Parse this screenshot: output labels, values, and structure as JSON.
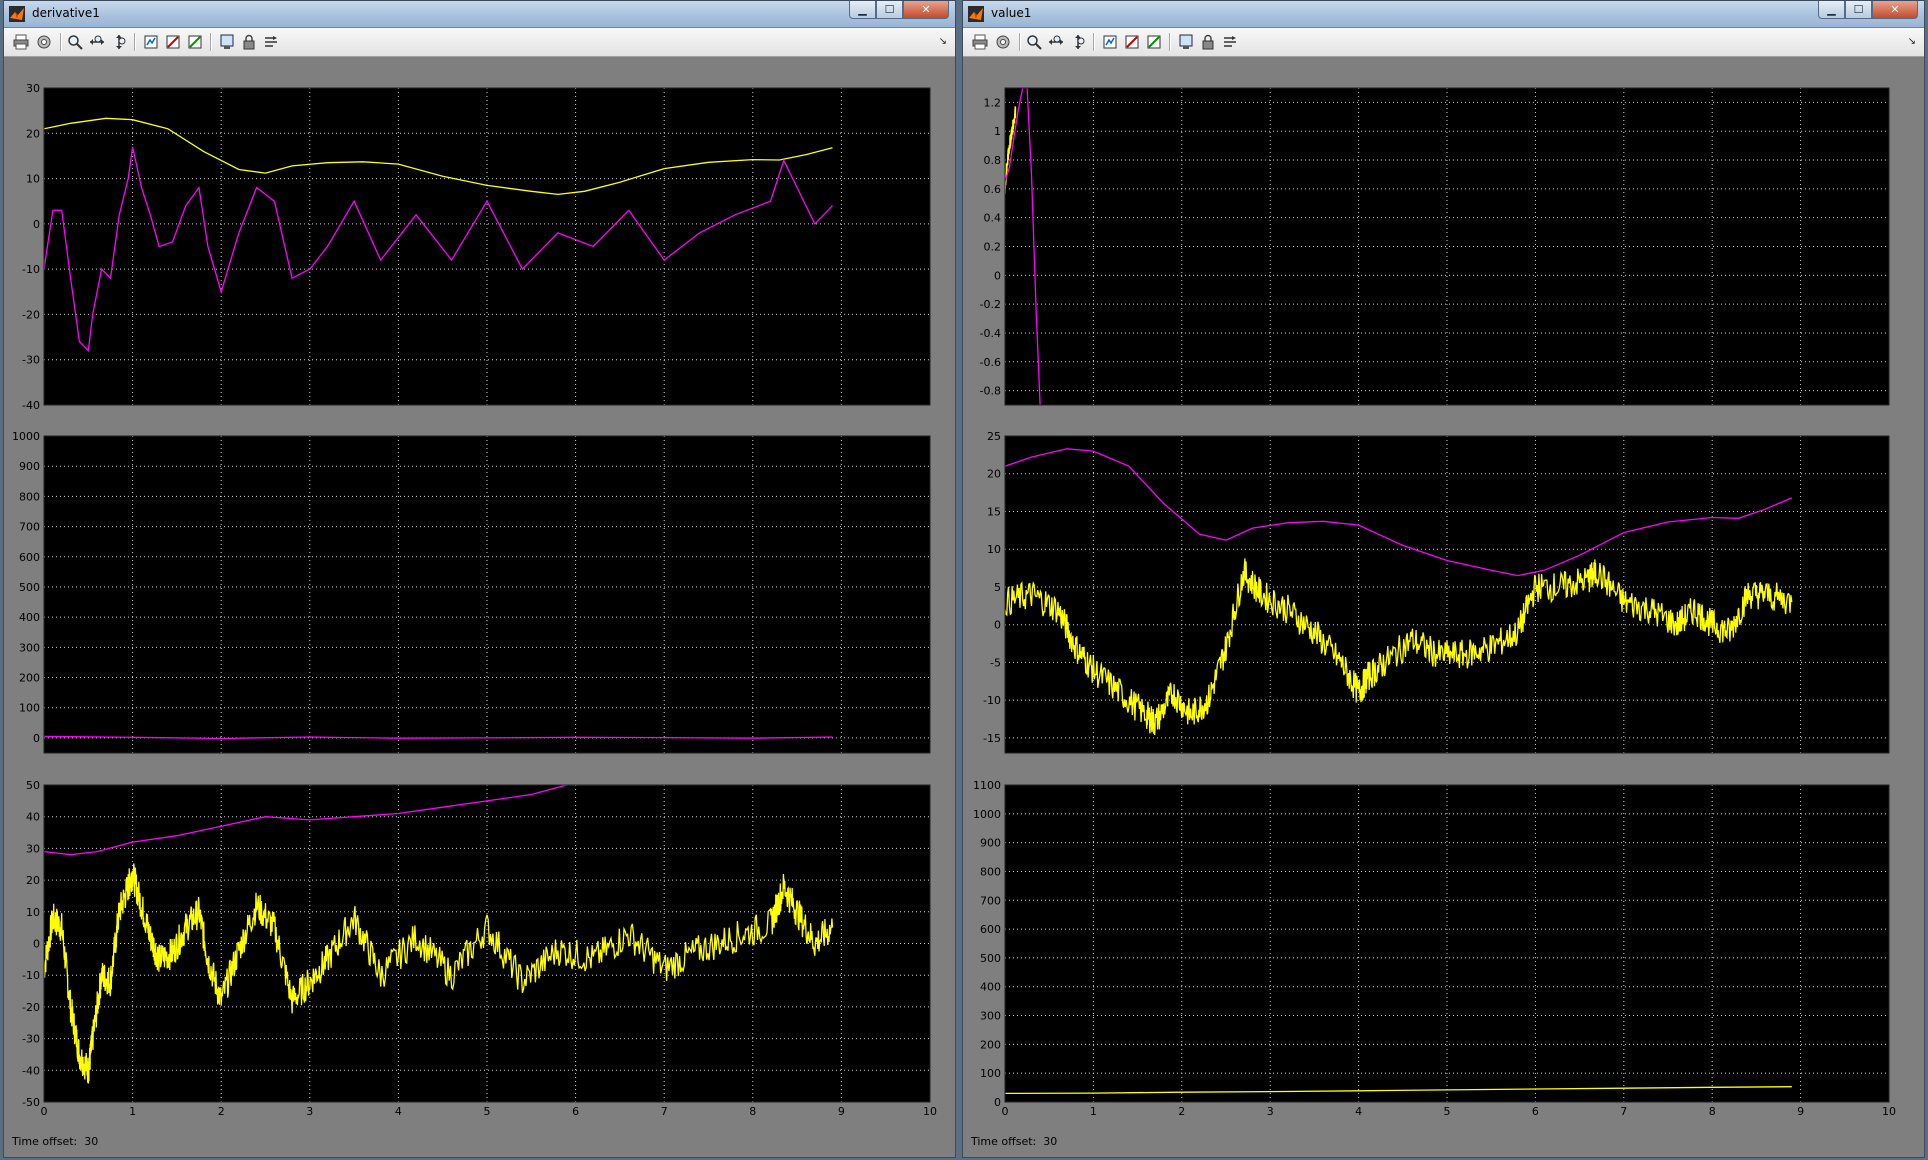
{
  "windows": [
    {
      "id": "derivative1",
      "title": "derivative1",
      "time_offset_label": "Time offset:",
      "time_offset_value": "30",
      "controls": {
        "minimize": "▁",
        "maximize": "☐",
        "close": "✕"
      }
    },
    {
      "id": "value1",
      "title": "value1",
      "time_offset_label": "Time offset:",
      "time_offset_value": "30",
      "controls": {
        "minimize": "▁",
        "maximize": "☐",
        "close": "✕"
      }
    }
  ],
  "toolbar_icons": [
    "print-icon",
    "parameters-icon",
    "zoom-icon",
    "zoom-x-icon",
    "zoom-y-icon",
    "autoscale-icon",
    "save-axes-icon",
    "restore-axes-icon",
    "floating-scope-icon",
    "lock-axes-icon",
    "signal-selection-icon",
    "dock-icon"
  ],
  "colors": {
    "magenta": "#ff00ff",
    "yellow": "#ffff00",
    "plot_bg": "#000000",
    "grid": "#cfcfcf"
  },
  "chart_data": [
    {
      "window": "derivative1",
      "type": "line",
      "xlim": [
        0,
        10
      ],
      "ylim": [
        -40,
        30
      ],
      "yticks": [
        -40,
        -30,
        -20,
        -10,
        0,
        10,
        20,
        30
      ],
      "xticks": [
        0,
        1,
        2,
        3,
        4,
        5,
        6,
        7,
        8,
        9,
        10
      ],
      "show_xtick_labels": false,
      "grid": true,
      "series": [
        {
          "color": "yellow",
          "x": [
            0,
            0.3,
            0.7,
            1.0,
            1.4,
            1.8,
            2.2,
            2.5,
            2.8,
            3.2,
            3.6,
            4.0,
            4.5,
            5.0,
            5.5,
            5.8,
            6.1,
            6.5,
            7.0,
            7.5,
            8.0,
            8.3,
            8.6,
            8.9
          ],
          "y": [
            21,
            22.2,
            23.3,
            23,
            21,
            16,
            12,
            11.2,
            12.8,
            13.5,
            13.7,
            13.2,
            10.5,
            8.5,
            7.2,
            6.5,
            7.2,
            9.2,
            12.2,
            13.6,
            14.2,
            14.1,
            15.3,
            16.8
          ]
        },
        {
          "color": "magenta",
          "x": [
            0,
            0.1,
            0.2,
            0.3,
            0.4,
            0.5,
            0.55,
            0.65,
            0.75,
            0.85,
            0.95,
            1.0,
            1.1,
            1.2,
            1.3,
            1.45,
            1.6,
            1.75,
            1.85,
            2.0,
            2.2,
            2.4,
            2.6,
            2.8,
            3.0,
            3.2,
            3.5,
            3.8,
            4.2,
            4.6,
            5.0,
            5.4,
            5.8,
            6.2,
            6.6,
            7.0,
            7.4,
            7.8,
            8.2,
            8.35,
            8.5,
            8.7,
            8.9
          ],
          "y": [
            -10,
            3,
            3,
            -12,
            -26,
            -28,
            -20,
            -10,
            -12,
            2,
            10,
            17,
            8,
            2,
            -5,
            -4,
            4,
            8,
            -5,
            -15,
            -2,
            8,
            5,
            -12,
            -10,
            -5,
            5,
            -8,
            2,
            -8,
            5,
            -10,
            -2,
            -5,
            3,
            -8,
            -2,
            2,
            5,
            14,
            8,
            0,
            4
          ]
        }
      ]
    },
    {
      "window": "derivative1",
      "type": "line",
      "xlim": [
        0,
        10
      ],
      "ylim": [
        -50,
        1000
      ],
      "yticks": [
        0,
        100,
        200,
        300,
        400,
        500,
        600,
        700,
        800,
        900,
        1000
      ],
      "xticks": [
        0,
        1,
        2,
        3,
        4,
        5,
        6,
        7,
        8,
        9,
        10
      ],
      "show_xtick_labels": false,
      "grid": true,
      "series": [
        {
          "color": "magenta",
          "x": [
            0,
            1,
            2,
            3,
            4,
            5,
            6,
            7,
            8,
            8.9
          ],
          "y": [
            5,
            2,
            -2,
            3,
            -1,
            0,
            2,
            1,
            -1,
            3
          ]
        }
      ]
    },
    {
      "window": "derivative1",
      "type": "line",
      "xlim": [
        0,
        10
      ],
      "ylim": [
        -50,
        50
      ],
      "yticks": [
        -50,
        -40,
        -30,
        -20,
        -10,
        0,
        10,
        20,
        30,
        40,
        50
      ],
      "xticks": [
        0,
        1,
        2,
        3,
        4,
        5,
        6,
        7,
        8,
        9,
        10
      ],
      "show_xtick_labels": true,
      "grid": true,
      "series": [
        {
          "color": "magenta",
          "x": [
            0,
            0.3,
            0.6,
            1.0,
            1.5,
            2.0,
            2.5,
            3.0,
            3.5,
            4.0,
            4.5,
            5.0,
            5.5,
            5.9,
            6.5,
            7.0
          ],
          "y": [
            29,
            28,
            29,
            32,
            34,
            37,
            40,
            39,
            40,
            41,
            43,
            45,
            47,
            50,
            50,
            50
          ]
        },
        {
          "color": "yellow",
          "x": [
            0,
            0.1,
            0.2,
            0.3,
            0.4,
            0.5,
            0.55,
            0.65,
            0.75,
            0.85,
            0.95,
            1.0,
            1.1,
            1.2,
            1.3,
            1.45,
            1.6,
            1.75,
            1.85,
            2.0,
            2.2,
            2.4,
            2.6,
            2.8,
            3.0,
            3.2,
            3.5,
            3.8,
            4.2,
            4.6,
            5.0,
            5.4,
            5.8,
            6.2,
            6.6,
            7.0,
            7.4,
            7.8,
            8.2,
            8.35,
            8.5,
            8.7,
            8.9
          ],
          "y": [
            -8,
            8,
            5,
            -20,
            -35,
            -40,
            -30,
            -10,
            -12,
            10,
            18,
            22,
            12,
            2,
            -5,
            -3,
            5,
            10,
            -5,
            -18,
            -2,
            12,
            5,
            -18,
            -12,
            -5,
            8,
            -10,
            2,
            -10,
            5,
            -12,
            -2,
            -5,
            3,
            -8,
            -2,
            2,
            6,
            18,
            10,
            0,
            5
          ],
          "noise": 5
        }
      ]
    },
    {
      "window": "value1",
      "type": "line",
      "xlim": [
        0,
        10
      ],
      "ylim": [
        -0.9,
        1.3
      ],
      "yticks": [
        -0.8,
        -0.6,
        -0.4,
        -0.2,
        0,
        0.2,
        0.4,
        0.6,
        0.8,
        1,
        1.2
      ],
      "xticks": [
        0,
        1,
        2,
        3,
        4,
        5,
        6,
        7,
        8,
        9,
        10
      ],
      "show_xtick_labels": false,
      "grid": true,
      "series": [
        {
          "color": "yellow",
          "x": [
            0,
            0.02,
            0.05,
            0.08,
            0.12
          ],
          "y": [
            0.6,
            0.75,
            0.9,
            1.0,
            1.15
          ],
          "noise": 0.05
        },
        {
          "color": "magenta",
          "x": [
            0,
            0.05,
            0.1,
            0.15,
            0.2,
            0.25,
            0.3,
            0.35,
            0.4
          ],
          "y": [
            0.65,
            0.75,
            0.95,
            1.15,
            1.3,
            1.3,
            0.7,
            -0.2,
            -0.95
          ]
        }
      ]
    },
    {
      "window": "value1",
      "type": "line",
      "xlim": [
        0,
        10
      ],
      "ylim": [
        -17,
        25
      ],
      "yticks": [
        -15,
        -10,
        -5,
        0,
        5,
        10,
        15,
        20,
        25
      ],
      "xticks": [
        0,
        1,
        2,
        3,
        4,
        5,
        6,
        7,
        8,
        9,
        10
      ],
      "show_xtick_labels": false,
      "grid": true,
      "series": [
        {
          "color": "magenta",
          "x": [
            0,
            0.3,
            0.7,
            1.0,
            1.4,
            1.8,
            2.2,
            2.5,
            2.8,
            3.2,
            3.6,
            4.0,
            4.5,
            5.0,
            5.5,
            5.8,
            6.1,
            6.5,
            7.0,
            7.5,
            8.0,
            8.3,
            8.6,
            8.9
          ],
          "y": [
            21,
            22.2,
            23.3,
            23,
            21,
            16,
            12,
            11.2,
            12.8,
            13.5,
            13.7,
            13.2,
            10.5,
            8.5,
            7.2,
            6.5,
            7.2,
            9.2,
            12.2,
            13.6,
            14.2,
            14.1,
            15.3,
            16.8
          ]
        },
        {
          "color": "yellow",
          "x": [
            0,
            0.3,
            0.6,
            0.8,
            1.0,
            1.3,
            1.6,
            1.7,
            1.9,
            2.1,
            2.3,
            2.5,
            2.7,
            2.9,
            3.2,
            3.5,
            3.8,
            4.0,
            4.1,
            4.3,
            4.6,
            4.9,
            5.2,
            5.5,
            5.8,
            6.0,
            6.3,
            6.6,
            6.7,
            7.0,
            7.3,
            7.6,
            7.8,
            8.0,
            8.2,
            8.4,
            8.6,
            8.9
          ],
          "y": [
            3,
            4,
            2,
            -3,
            -6,
            -9,
            -12,
            -13,
            -9,
            -12,
            -10,
            -3,
            7,
            4,
            2,
            -1,
            -5,
            -9,
            -7,
            -5,
            -2,
            -4,
            -4,
            -3,
            -1,
            5,
            5,
            6,
            7,
            3,
            2,
            0,
            2,
            0,
            -1,
            4,
            4,
            3
          ],
          "noise": 2
        }
      ]
    },
    {
      "window": "value1",
      "type": "line",
      "xlim": [
        0,
        10
      ],
      "ylim": [
        0,
        1100
      ],
      "yticks": [
        0,
        100,
        200,
        300,
        400,
        500,
        600,
        700,
        800,
        900,
        1000,
        1100
      ],
      "xticks": [
        0,
        1,
        2,
        3,
        4,
        5,
        6,
        7,
        8,
        9,
        10
      ],
      "show_xtick_labels": true,
      "grid": true,
      "series": [
        {
          "color": "yellow",
          "x": [
            0,
            1,
            2,
            3,
            4,
            5,
            6,
            7,
            8,
            8.9
          ],
          "y": [
            30,
            31,
            34,
            36,
            39,
            42,
            45,
            48,
            51,
            53
          ]
        }
      ]
    }
  ]
}
